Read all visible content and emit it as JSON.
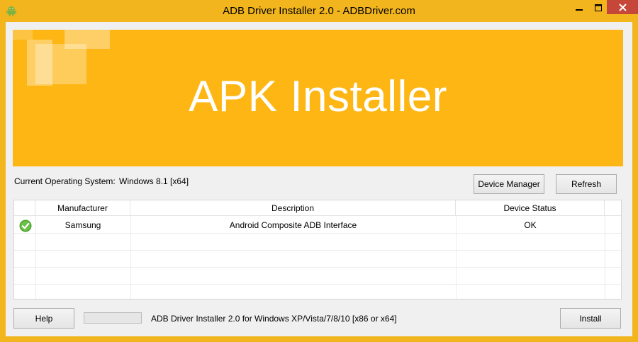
{
  "window": {
    "title": "ADB Driver Installer 2.0 - ADBDriver.com",
    "icon": "android-icon"
  },
  "banner": {
    "title": "APK Installer",
    "color": "#fdb614"
  },
  "system": {
    "label": "Current Operating System:",
    "value": "Windows 8.1  [x64]"
  },
  "buttons": {
    "device_manager": "Device Manager",
    "refresh": "Refresh",
    "help": "Help",
    "install": "Install"
  },
  "table": {
    "columns": [
      "",
      "Manufacturer",
      "Description",
      "Device Status"
    ],
    "rows": [
      {
        "status_icon": "check-icon",
        "manufacturer": "Samsung",
        "description": "Android Composite ADB Interface",
        "device_status": "OK"
      }
    ]
  },
  "progress": {
    "value": 0
  },
  "status_text": "ADB Driver Installer 2.0 for Windows XP/Vista/7/8/10 [x86 or x64]",
  "colors": {
    "frame": "#f2b51d",
    "close": "#c7463a",
    "ok": "#4aa32a"
  }
}
